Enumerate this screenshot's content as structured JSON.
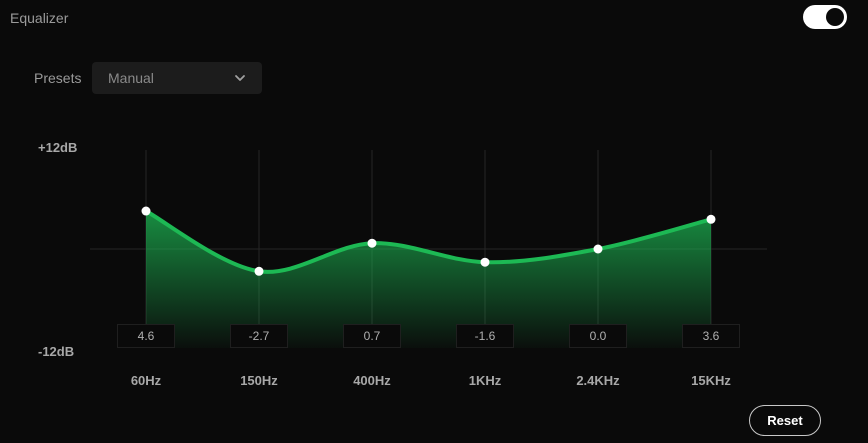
{
  "header": {
    "title": "Equalizer",
    "enabled": true
  },
  "presets": {
    "label": "Presets",
    "selected": "Manual"
  },
  "scale": {
    "max_label": "+12dB",
    "min_label": "-12dB",
    "max_db": 12,
    "min_db": -12
  },
  "bands": [
    {
      "freq": "60Hz",
      "value": "4.6"
    },
    {
      "freq": "150Hz",
      "value": "-2.7"
    },
    {
      "freq": "400Hz",
      "value": "0.7"
    },
    {
      "freq": "1KHz",
      "value": "-1.6"
    },
    {
      "freq": "2.4KHz",
      "value": "0.0"
    },
    {
      "freq": "15KHz",
      "value": "3.6"
    }
  ],
  "colors": {
    "accent": "#1db954",
    "background": "#0a0a0a"
  },
  "reset_label": "Reset"
}
